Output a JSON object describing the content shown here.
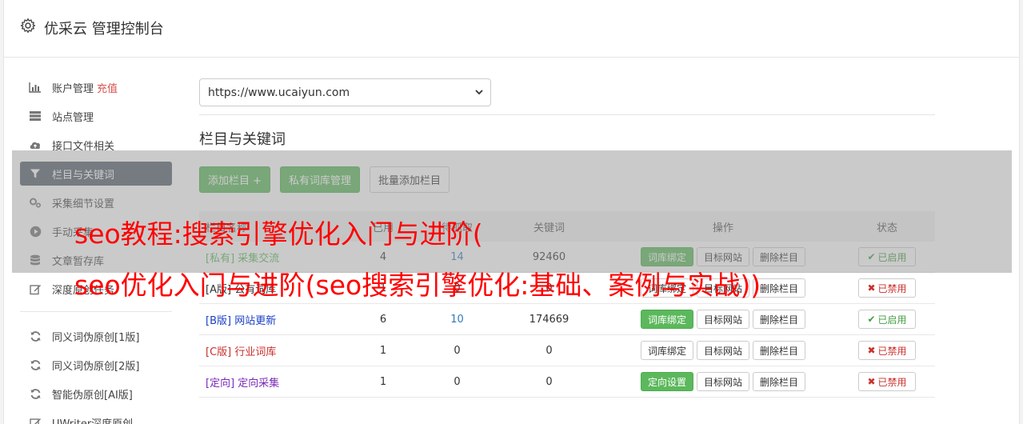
{
  "app": {
    "title": "优采云 管理控制台"
  },
  "sidebar": {
    "items": [
      {
        "label": "账户管理",
        "extra": "充值",
        "icon": "bar-chart-icon"
      },
      {
        "label": "站点管理",
        "icon": "server-icon"
      },
      {
        "label": "接口文件相关",
        "icon": "cloud-upload-icon"
      },
      {
        "label": "栏目与关键词",
        "icon": "filter-icon",
        "active": true
      },
      {
        "label": "采集细节设置",
        "icon": "gears-icon"
      },
      {
        "label": "手动采集",
        "icon": "play-circle-icon"
      },
      {
        "label": "文章暂存库",
        "icon": "database-icon"
      },
      {
        "label": "深度原创任务",
        "icon": "edit-icon"
      }
    ],
    "items2": [
      {
        "label": "同义词伪原创[1版]",
        "icon": "refresh-icon"
      },
      {
        "label": "同义词伪原创[2版]",
        "icon": "refresh-icon"
      },
      {
        "label": "智能伪原创[AI版]",
        "icon": "refresh-icon"
      },
      {
        "label": "UWriter深度原创",
        "icon": "edit-icon"
      }
    ]
  },
  "main": {
    "site_select": {
      "value": "https://www.ucaiyun.com"
    },
    "section_title": "栏目与关键词",
    "buttons": {
      "add": "添加栏目 +",
      "private": "私有词库管理",
      "batch": "批量添加栏目"
    },
    "table": {
      "headers": {
        "name": "栏目名称",
        "col1": "已用",
        "col2": "待抓取",
        "col3": "关键词",
        "ops": "操作",
        "status": "状态"
      },
      "rows": [
        {
          "tag": "[私有]",
          "name": "采集交流",
          "tag_class": "private",
          "n1": "4",
          "n2": "14",
          "n3": "92460",
          "op1": "词库绑定",
          "op1_green": true,
          "op2": "目标网站",
          "op3": "删除栏目",
          "status": "已启用",
          "enabled": true
        },
        {
          "tag": "[A版]",
          "name": "公有词库",
          "tag_class": "a",
          "n1": "1",
          "n2": "0",
          "n3": "0",
          "op1": "词库绑定",
          "op1_green": false,
          "op2": "目标网站",
          "op3": "删除栏目",
          "status": "已禁用",
          "enabled": false
        },
        {
          "tag": "[B版]",
          "name": "网站更新",
          "tag_class": "b",
          "n1": "6",
          "n2": "10",
          "n3": "174669",
          "op1": "词库绑定",
          "op1_green": true,
          "op2": "目标网站",
          "op3": "删除栏目",
          "status": "已启用",
          "enabled": true
        },
        {
          "tag": "[C版]",
          "name": "行业词库",
          "tag_class": "c",
          "n1": "1",
          "n2": "0",
          "n3": "0",
          "op1": "词库绑定",
          "op1_green": false,
          "op2": "目标网站",
          "op3": "删除栏目",
          "status": "已禁用",
          "enabled": false
        },
        {
          "tag": "[定向]",
          "name": "定向采集",
          "tag_class": "d",
          "n1": "1",
          "n2": "0",
          "n3": "0",
          "op1": "定向设置",
          "op1_green": true,
          "op2": "目标网站",
          "op3": "删除栏目",
          "status": "已禁用",
          "enabled": false
        }
      ]
    }
  },
  "watermark": {
    "line1": "seo教程:搜索引擎优化入门与进阶(",
    "line2": "seo优化入门与进阶(seo搜索引擎优化:基础、案例与实战))"
  }
}
